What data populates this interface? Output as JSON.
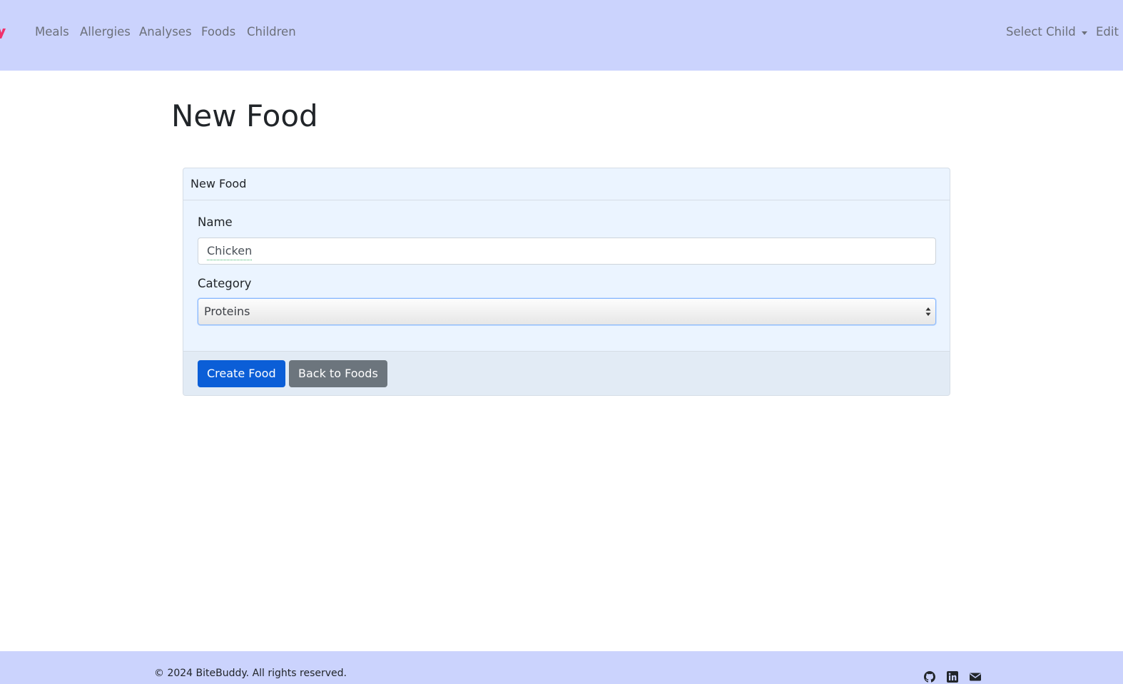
{
  "nav": {
    "links": [
      "Meals",
      "Allergies",
      "Analyses",
      "Foods",
      "Children"
    ],
    "select_child": "Select Child",
    "edit_partial": "Edit F"
  },
  "page": {
    "title": "New Food"
  },
  "card": {
    "header": "New Food",
    "name_label": "Name",
    "name_value": "Chicken",
    "category_label": "Category",
    "category_value": "Proteins",
    "create_button": "Create Food",
    "back_button": "Back to Foods"
  },
  "footer": {
    "copyright": "© 2024 BiteBuddy. All rights reserved.",
    "icons": [
      "github-icon",
      "linkedin-icon",
      "mail-icon"
    ]
  },
  "colors": {
    "navbar": "#cbd3fd",
    "brand_accent": "#f0306a",
    "primary": "#0b5ed7",
    "secondary": "#6c757d",
    "card_bg": "#ebf4ff"
  }
}
